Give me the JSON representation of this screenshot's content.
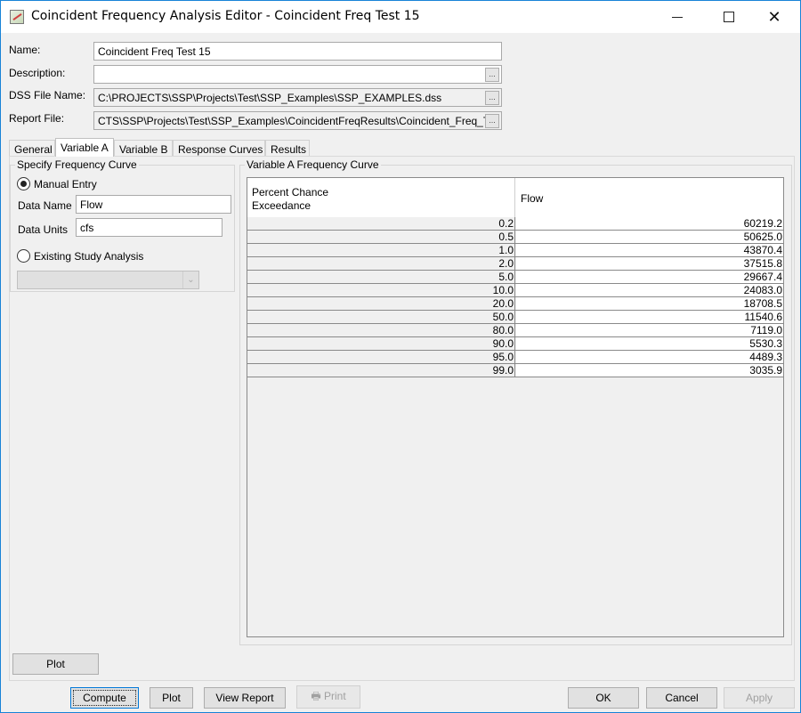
{
  "window": {
    "title": "Coincident Frequency Analysis Editor - Coincident Freq Test 15",
    "controls": {
      "minimize": "minimize",
      "maximize": "maximize",
      "close": "✕"
    }
  },
  "form": {
    "name_label": "Name:",
    "name_value": "Coincident Freq Test 15",
    "description_label": "Description:",
    "description_value": "",
    "dss_label": "DSS File Name:",
    "dss_value": "C:\\PROJECTS\\SSP\\Projects\\Test\\SSP_Examples\\SSP_EXAMPLES.dss",
    "report_label": "Report File:",
    "report_value": "CTS\\SSP\\Projects\\Test\\SSP_Examples\\CoincidentFreqResults\\Coincident_Freq_Te",
    "browse_label": "..."
  },
  "tabs": [
    {
      "label": "General",
      "active": false
    },
    {
      "label": "Variable A",
      "active": true
    },
    {
      "label": "Variable B",
      "active": false
    },
    {
      "label": "Response Curves",
      "active": false
    },
    {
      "label": "Results",
      "active": false
    }
  ],
  "specify": {
    "title": "Specify Frequency Curve",
    "manual_entry_label": "Manual Entry",
    "manual_entry_selected": true,
    "data_name_label": "Data Name",
    "data_name_value": "Flow",
    "data_units_label": "Data Units",
    "data_units_value": "cfs",
    "existing_label": "Existing Study Analysis",
    "existing_selected": false,
    "existing_value": ""
  },
  "curve": {
    "title": "Variable A Frequency Curve",
    "columns": [
      "Percent Chance\nExceedance",
      "Flow"
    ],
    "column1_line1": "Percent Chance",
    "column1_line2": "Exceedance",
    "column2": "Flow",
    "rows": [
      [
        "0.2",
        "60219.2"
      ],
      [
        "0.5",
        "50625.0"
      ],
      [
        "1.0",
        "43870.4"
      ],
      [
        "2.0",
        "37515.8"
      ],
      [
        "5.0",
        "29667.4"
      ],
      [
        "10.0",
        "24083.0"
      ],
      [
        "20.0",
        "18708.5"
      ],
      [
        "50.0",
        "11540.6"
      ],
      [
        "80.0",
        "7119.0"
      ],
      [
        "90.0",
        "5530.3"
      ],
      [
        "95.0",
        "4489.3"
      ],
      [
        "99.0",
        "3035.9"
      ]
    ]
  },
  "buttons": {
    "panel_plot": "Plot",
    "compute": "Compute",
    "plot": "Plot",
    "view_report": "View Report",
    "print": "Print",
    "ok": "OK",
    "cancel": "Cancel",
    "apply": "Apply"
  }
}
